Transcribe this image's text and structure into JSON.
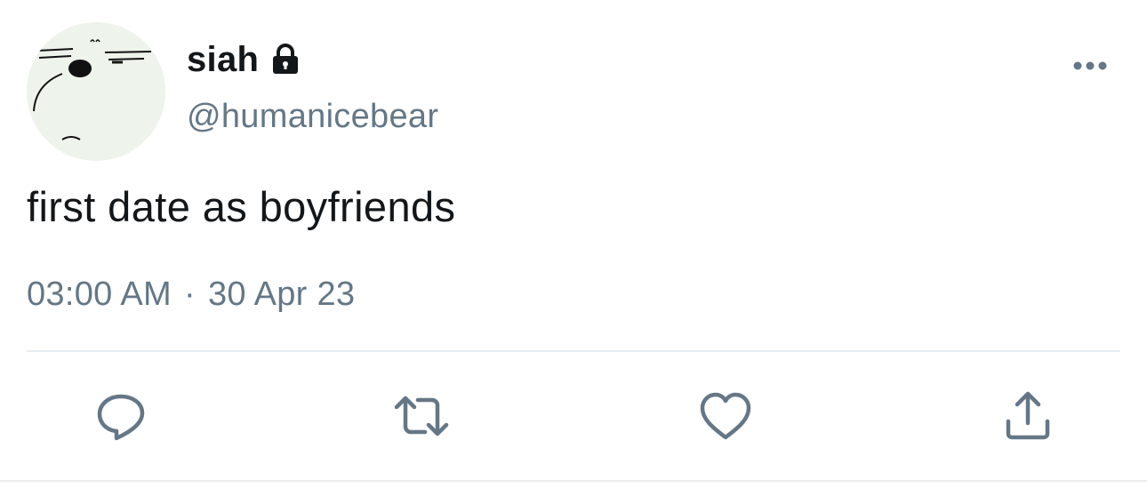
{
  "tweet": {
    "display_name": "siah",
    "handle": "@humanicebear",
    "text": "first date as boyfriends",
    "time": "03:00 AM",
    "separator": "·",
    "date": "30 Apr 23"
  },
  "icons": {
    "lock": "lock-icon",
    "more": "more-horizontal-icon",
    "reply": "reply-icon",
    "retweet": "retweet-icon",
    "like": "heart-icon",
    "share": "share-icon"
  },
  "colors": {
    "text_primary": "#14171a",
    "text_secondary": "#657786",
    "icon": "#657786",
    "divider": "#e6ecf0"
  }
}
